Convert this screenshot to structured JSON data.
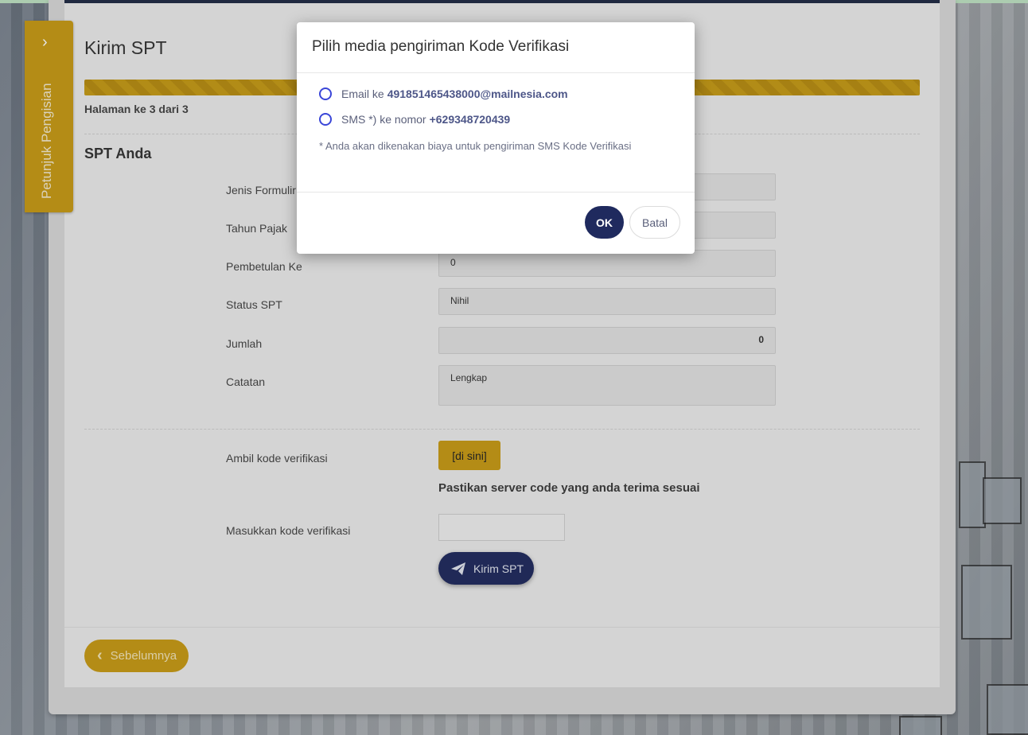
{
  "page": {
    "title": "Kirim SPT",
    "page_indicator": "Halaman ke 3 dari 3",
    "section_title": "SPT Anda",
    "side_tab_label": "Petunjuk Pengisian"
  },
  "form": {
    "jenis_formulir_label": "Jenis Formulir",
    "tahun_pajak_label": "Tahun Pajak",
    "pembetulan_label": "Pembetulan Ke",
    "pembetulan_value": "0",
    "status_label": "Status SPT",
    "status_value": "Nihil",
    "jumlah_label": "Jumlah",
    "jumlah_value": "0",
    "catatan_label": "Catatan",
    "catatan_value": "Lengkap",
    "ambil_kode_label": "Ambil kode verifikasi",
    "di_sini_button": "[di sini]",
    "server_note": "Pastikan server code yang anda terima sesuai",
    "masukkan_kode_label": "Masukkan kode verifikasi",
    "kirim_button": "Kirim SPT",
    "prev_button": "Sebelumnya"
  },
  "modal": {
    "title": "Pilih media pengiriman Kode Verifikasi",
    "email_prefix": "Email ke",
    "email_value": "491851465438000@mailnesia.com",
    "sms_prefix": "SMS *) ke nomor",
    "sms_value": "+629348720439",
    "fine_print": "* Anda akan dikenakan biaya untuk pengiriman SMS Kode Verifikasi",
    "ok_button": "OK",
    "cancel_button": "Batal"
  },
  "colors": {
    "primary": "#1f2a5e",
    "accent": "#c89a14",
    "radio": "#3a46d8"
  }
}
